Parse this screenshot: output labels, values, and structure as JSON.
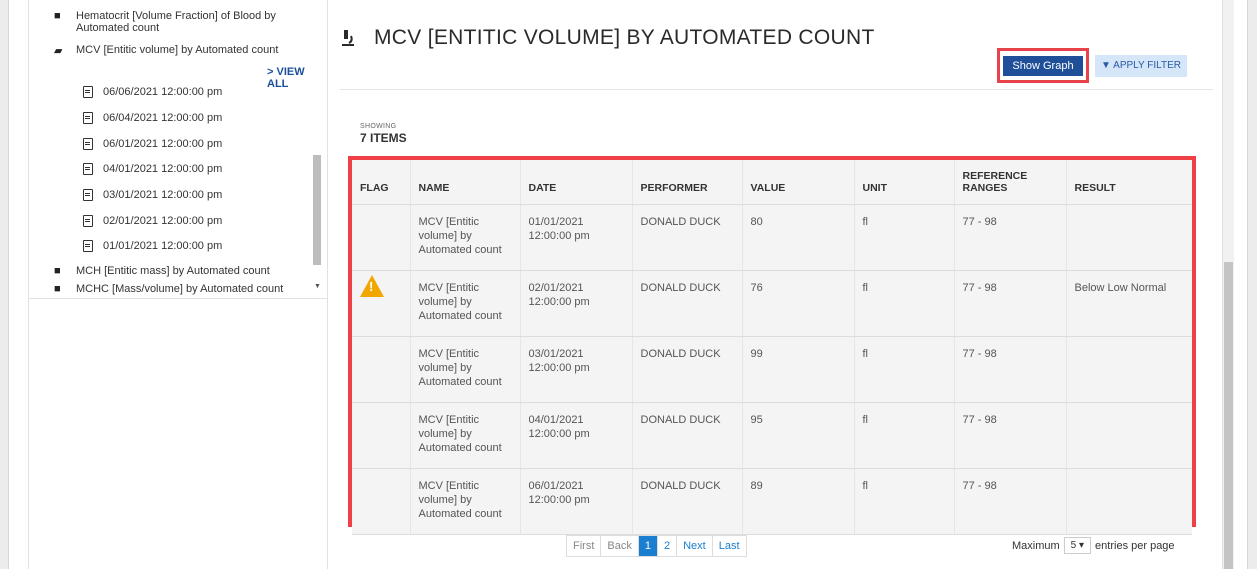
{
  "tree": {
    "items": [
      {
        "label": "Hematocrit [Volume Fraction] of Blood by Automated count",
        "icon": "folder-icon"
      },
      {
        "label": "MCV [Entitic volume] by Automated count",
        "icon": "folder-open-icon"
      }
    ],
    "view_all": "> VIEW ALL",
    "dates": [
      "06/06/2021 12:00:00 pm",
      "06/04/2021 12:00:00 pm",
      "06/01/2021 12:00:00 pm",
      "04/01/2021 12:00:00 pm",
      "03/01/2021 12:00:00 pm",
      "02/01/2021 12:00:00 pm",
      "01/01/2021 12:00:00 pm"
    ],
    "more_items": [
      {
        "label": "MCH [Entitic mass] by Automated count",
        "icon": "folder-icon"
      },
      {
        "label": "MCHC [Mass/volume] by Automated count",
        "icon": "folder-icon"
      }
    ]
  },
  "main": {
    "title": "MCV [ENTITIC VOLUME] BY AUTOMATED COUNT",
    "show_graph": "Show Graph",
    "apply_filter": "APPLY FILTER",
    "showing_label": "SHOWING",
    "showing_count": "7 ITEMS"
  },
  "table": {
    "headers": [
      "FLAG",
      "NAME",
      "DATE",
      "PERFORMER",
      "VALUE",
      "UNIT",
      "REFERENCE RANGES",
      "RESULT"
    ],
    "rows": [
      {
        "flag": false,
        "name": "MCV [Entitic volume] by Automated count",
        "date": "01/01/2021 12:00:00 pm",
        "performer": "DONALD DUCK",
        "value": "80",
        "unit": "fl",
        "range": "77 - 98",
        "result": ""
      },
      {
        "flag": true,
        "name": "MCV [Entitic volume] by Automated count",
        "date": "02/01/2021 12:00:00 pm",
        "performer": "DONALD DUCK",
        "value": "76",
        "unit": "fl",
        "range": "77 - 98",
        "result": "Below Low Normal"
      },
      {
        "flag": false,
        "name": "MCV [Entitic volume] by Automated count",
        "date": "03/01/2021 12:00:00 pm",
        "performer": "DONALD DUCK",
        "value": "99",
        "unit": "fl",
        "range": "77 - 98",
        "result": ""
      },
      {
        "flag": false,
        "name": "MCV [Entitic volume] by Automated count",
        "date": "04/01/2021 12:00:00 pm",
        "performer": "DONALD DUCK",
        "value": "95",
        "unit": "fl",
        "range": "77 - 98",
        "result": ""
      },
      {
        "flag": false,
        "name": "MCV [Entitic volume] by Automated count",
        "date": "06/01/2021 12:00:00 pm",
        "performer": "DONALD DUCK",
        "value": "89",
        "unit": "fl",
        "range": "77 - 98",
        "result": ""
      }
    ]
  },
  "pager": {
    "first": "First",
    "back": "Back",
    "pages": [
      "1",
      "2"
    ],
    "next": "Next",
    "last": "Last",
    "maximum": "Maximum",
    "per_page_value": "5",
    "per_page_suffix": "entries per page"
  },
  "colors": {
    "highlight": "#ef4047",
    "primary": "#1e4f98",
    "warning": "#f0a800"
  }
}
